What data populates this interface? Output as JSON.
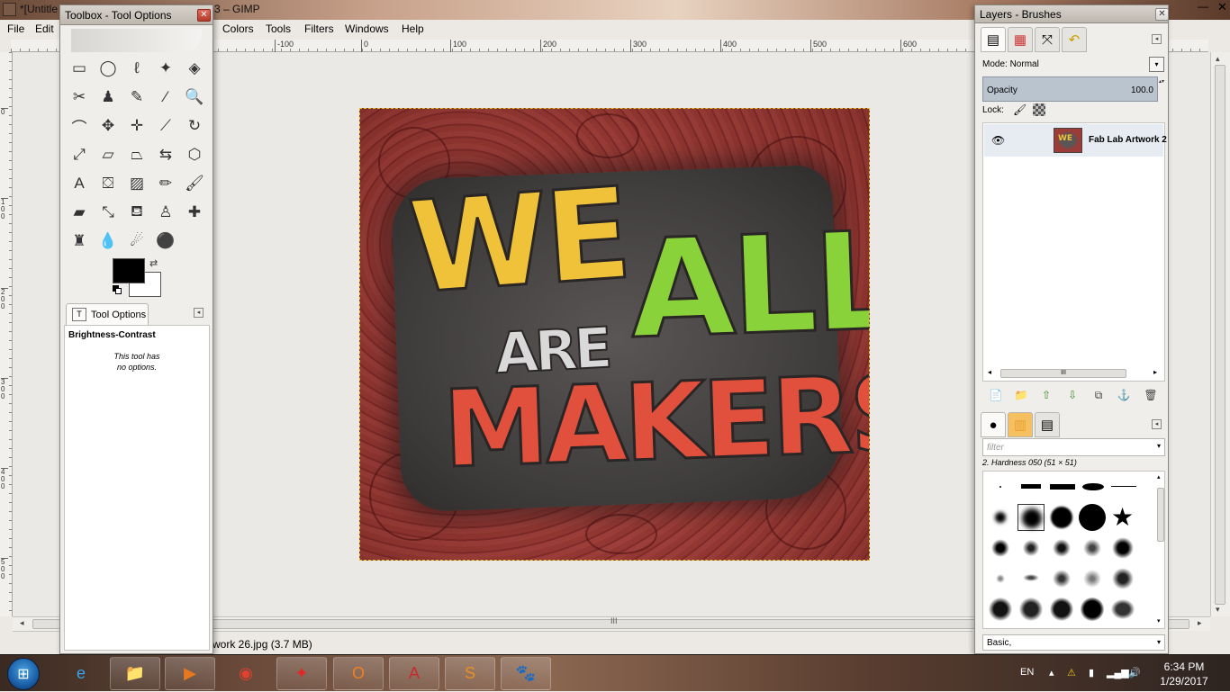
{
  "window": {
    "title_prefix": "*[Untitle",
    "title_suffix": "3 – GIMP",
    "minimize": "—",
    "close": "✕"
  },
  "menubar": {
    "items": [
      "File",
      "Edit",
      "Colors",
      "Tools",
      "Filters",
      "Windows",
      "Help"
    ]
  },
  "rulers": {
    "h_ticks": [
      "-100",
      "0",
      "100",
      "200",
      "300",
      "400",
      "500",
      "600"
    ],
    "v_ticks": [
      "0",
      "100",
      "200",
      "300",
      "400",
      "500"
    ]
  },
  "canvas": {
    "words": [
      "WE",
      "ALL",
      "ARE",
      "MAKERS"
    ]
  },
  "scrollbars": {
    "grip": "III"
  },
  "status": {
    "text": "work 26.jpg (3.7 MB)"
  },
  "toolbox": {
    "title": "Toolbox - Tool Options",
    "close": "✕",
    "tools": [
      {
        "name": "rect-select-icon",
        "glyph": "▭"
      },
      {
        "name": "ellipse-select-icon",
        "glyph": "◯"
      },
      {
        "name": "free-select-icon",
        "glyph": "ℓ"
      },
      {
        "name": "fuzzy-select-icon",
        "glyph": "✦"
      },
      {
        "name": "select-by-color-icon",
        "glyph": "◈"
      },
      {
        "name": "scissors-select-icon",
        "glyph": "✂"
      },
      {
        "name": "foreground-select-icon",
        "glyph": "♟"
      },
      {
        "name": "paths-icon",
        "glyph": "✎"
      },
      {
        "name": "color-picker-icon",
        "glyph": "⁄"
      },
      {
        "name": "zoom-icon",
        "glyph": "🔍"
      },
      {
        "name": "measure-icon",
        "glyph": "⌒"
      },
      {
        "name": "move-icon",
        "glyph": "✥"
      },
      {
        "name": "align-icon",
        "glyph": "✛"
      },
      {
        "name": "crop-icon",
        "glyph": "⟋"
      },
      {
        "name": "rotate-icon",
        "glyph": "↻"
      },
      {
        "name": "scale-icon",
        "glyph": "⤢"
      },
      {
        "name": "shear-icon",
        "glyph": "▱"
      },
      {
        "name": "perspective-icon",
        "glyph": "⏢"
      },
      {
        "name": "flip-icon",
        "glyph": "⇆"
      },
      {
        "name": "cage-transform-icon",
        "glyph": "⬡"
      },
      {
        "name": "text-icon",
        "glyph": "A"
      },
      {
        "name": "bucket-fill-icon",
        "glyph": "⛋"
      },
      {
        "name": "blend-icon",
        "glyph": "▨"
      },
      {
        "name": "pencil-icon",
        "glyph": "✏"
      },
      {
        "name": "paintbrush-icon",
        "glyph": "🖌"
      },
      {
        "name": "eraser-icon",
        "glyph": "▰"
      },
      {
        "name": "airbrush-icon",
        "glyph": "⤡"
      },
      {
        "name": "ink-icon",
        "glyph": "⛾"
      },
      {
        "name": "clone-icon",
        "glyph": "♙"
      },
      {
        "name": "heal-icon",
        "glyph": "✚"
      },
      {
        "name": "perspective-clone-icon",
        "glyph": "♜"
      },
      {
        "name": "blur-icon",
        "glyph": "💧"
      },
      {
        "name": "smudge-icon",
        "glyph": "☄"
      },
      {
        "name": "dodge-burn-icon",
        "glyph": "⚫"
      }
    ],
    "swap_glyph": "⇄",
    "tab_label": "Tool Options",
    "tab_icon": "T",
    "tool_name": "Brightness-Contrast",
    "no_options_line1": "This tool has",
    "no_options_line2": "no options.",
    "menu_arrow": "◂"
  },
  "dock": {
    "title": "Layers - Brushes",
    "close": "✕",
    "tabs": [
      "layers-tab-icon",
      "channels-tab-icon",
      "paths-tab-icon",
      "undo-tab-icon"
    ],
    "tab_glyphs": [
      "▤",
      "▦",
      "⤧",
      "↶"
    ],
    "mode_label": "Mode:",
    "mode_value": "Normal",
    "dropdown": "▾",
    "opacity_label": "Opacity",
    "opacity_value": "100.0",
    "spin": "▴▾",
    "lock_label": "Lock:",
    "lock_brush": "🖌",
    "eye": "👁",
    "layer_name": "Fab Lab Artwork 2",
    "layer_thumb_text": "WE",
    "hscroll": "III",
    "layer_buttons": [
      "📄",
      "📁",
      "⇧",
      "⇩",
      "⧉",
      "⚓",
      "🗑"
    ],
    "brush_tab_glyphs": [
      "●",
      "▥",
      "▤"
    ],
    "filter_placeholder": "filter",
    "brush_name": "2. Hardness 050 (51 × 51)",
    "preset": "Basic,"
  },
  "taskbar": {
    "start": "⊞",
    "apps": [
      {
        "name": "ie-taskbar-button",
        "glyph": "e"
      },
      {
        "name": "explorer-taskbar-button",
        "glyph": "📁"
      },
      {
        "name": "media-player-taskbar-button",
        "glyph": "▶"
      },
      {
        "name": "chrome-taskbar-button",
        "glyph": "◉"
      },
      {
        "name": "app-red-taskbar-button",
        "glyph": "✦"
      },
      {
        "name": "outlook-taskbar-button",
        "glyph": "O"
      },
      {
        "name": "acrobat-taskbar-button",
        "glyph": "A"
      },
      {
        "name": "sublime-taskbar-button",
        "glyph": "S"
      },
      {
        "name": "gimp-taskbar-button",
        "glyph": "🐾"
      }
    ],
    "lang": "EN",
    "tray_icons": [
      "▴",
      "⚠",
      "▮",
      "▂▄▆",
      "🔊"
    ],
    "time": "6:34 PM",
    "date": "1/29/2017"
  }
}
